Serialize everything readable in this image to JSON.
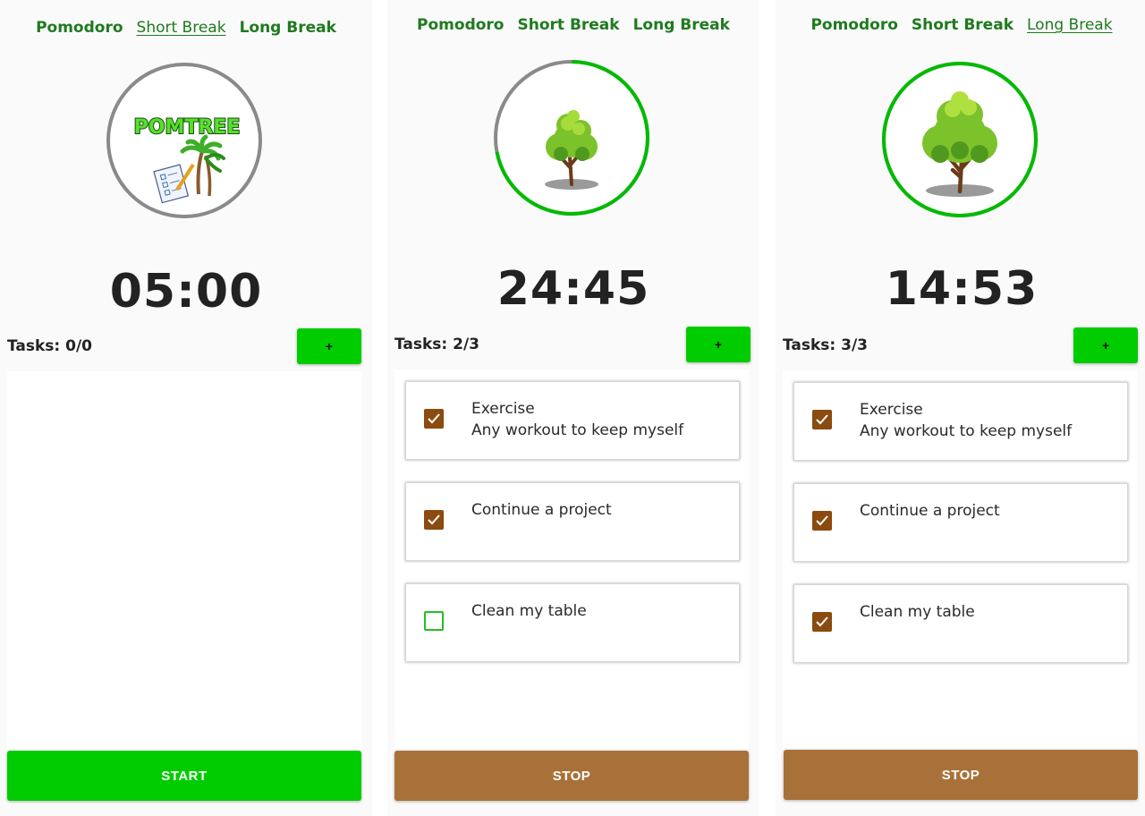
{
  "screens": [
    {
      "tabs": [
        {
          "label": "Pomodoro",
          "active": false
        },
        {
          "label": "Short Break",
          "active": true
        },
        {
          "label": "Long Break",
          "active": false
        }
      ],
      "illustration": "pomtree-logo",
      "logo_text": "POMTREE",
      "progress_ring": 0,
      "timer": "05:00",
      "tasks_label": "Tasks: 0/0",
      "add_button_label": "+",
      "tasks": [],
      "action_button_label": "START",
      "action_button_color": "#00cc00"
    },
    {
      "tabs": [
        {
          "label": "Pomodoro",
          "active": false
        },
        {
          "label": "Short Break",
          "active": false
        },
        {
          "label": "Long Break",
          "active": false
        }
      ],
      "illustration": "small-tree",
      "progress_ring": 0.72,
      "timer": "24:45",
      "tasks_label": "Tasks: 2/3",
      "add_button_label": "+",
      "tasks": [
        {
          "title": "Exercise",
          "description": "Any workout to keep myself",
          "checked": true
        },
        {
          "title": "Continue a project",
          "description": "",
          "checked": true
        },
        {
          "title": "Clean my table",
          "description": "",
          "checked": false
        }
      ],
      "action_button_label": "STOP",
      "action_button_color": "#a9713a"
    },
    {
      "tabs": [
        {
          "label": "Pomodoro",
          "active": false
        },
        {
          "label": "Short Break",
          "active": false
        },
        {
          "label": "Long Break",
          "active": true
        }
      ],
      "illustration": "large-tree",
      "progress_ring": 1,
      "timer": "14:53",
      "tasks_label": "Tasks: 3/3",
      "add_button_label": "+",
      "tasks": [
        {
          "title": "Exercise",
          "description": "Any workout to keep myself",
          "checked": true
        },
        {
          "title": "Continue a project",
          "description": "",
          "checked": true
        },
        {
          "title": "Clean my table",
          "description": "",
          "checked": true
        }
      ],
      "action_button_label": "STOP",
      "action_button_color": "#a9713a"
    }
  ],
  "colors": {
    "tab_text": "#1f7a1f",
    "accent_green": "#00cc00",
    "ring_gray": "#8a8a8a",
    "checkbox_checked": "#8b4a0f",
    "stop_brown": "#a9713a"
  }
}
